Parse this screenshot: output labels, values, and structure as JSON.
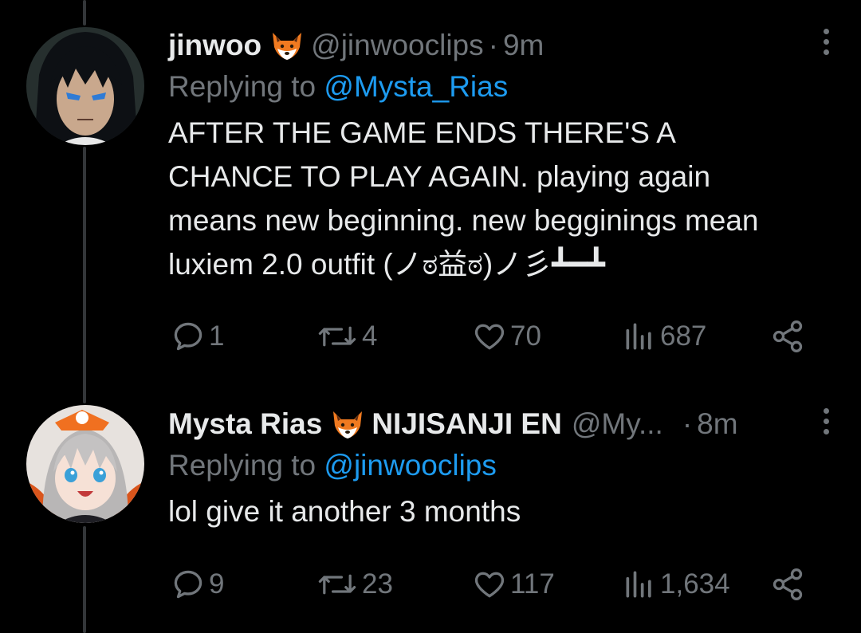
{
  "tweets": [
    {
      "display_name": "jinwoo",
      "handle": "@jinwooclips",
      "separator": "·",
      "time": "9m",
      "reply_prefix": "Replying to",
      "reply_to": "@Mysta_Rias",
      "text_lines": [
        "AFTER THE GAME ENDS THERE'S A",
        "CHANCE TO PLAY AGAIN. playing again",
        "means new beginning. new begginings mean",
        "luxiem 2.0 outfit (ノಠ益ಠ)ノ彡┻━┻"
      ],
      "replies": "1",
      "retweets": "4",
      "likes": "70",
      "views": "687",
      "avatar_icon": "dark-haired-anime-avatar"
    },
    {
      "display_name": "Mysta Rias",
      "affiliation": "NIJISANJI EN",
      "handle": "@My...",
      "separator": "·",
      "time": "8m",
      "reply_prefix": "Replying to",
      "reply_to": "@jinwooclips",
      "text_lines": [
        "lol give it another 3 months"
      ],
      "replies": "9",
      "retweets": "23",
      "likes": "117",
      "views": "1,634",
      "avatar_icon": "fox-eared-anime-avatar"
    }
  ],
  "colors": {
    "background": "#000000",
    "text": "#e7e9ea",
    "muted": "#71767b",
    "mention": "#1d9bf0",
    "thread_line": "#333639"
  }
}
